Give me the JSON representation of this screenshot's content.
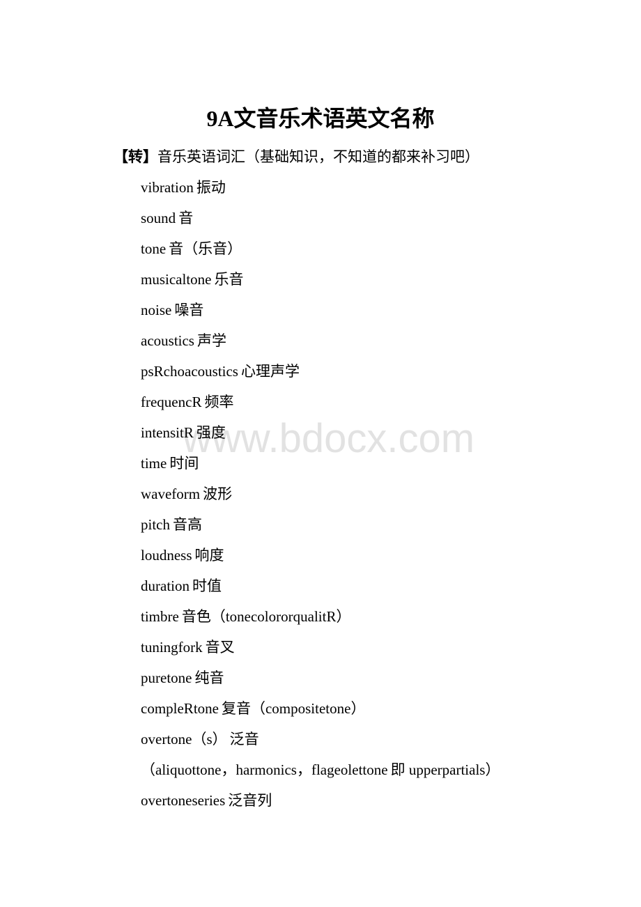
{
  "watermark": "www.bdocx.com",
  "document": {
    "title": "9A文音乐术语英文名称",
    "subtitle_tag": "【转】",
    "subtitle_text": "音乐英语词汇（基础知识，不知道的都来补习吧）",
    "terms": [
      {
        "en": "vibration",
        "zh": "振动"
      },
      {
        "en": "sound",
        "zh": "音"
      },
      {
        "en": "tone",
        "zh": "音（乐音）"
      },
      {
        "en": "musicaltone",
        "zh": "乐音"
      },
      {
        "en": "noise",
        "zh": "噪音"
      },
      {
        "en": "acoustics",
        "zh": "声学"
      },
      {
        "en": "psRchoacoustics",
        "zh": "心理声学"
      },
      {
        "en": "frequencR",
        "zh": "频率"
      },
      {
        "en": "intensitR",
        "zh": "强度"
      },
      {
        "en": "time",
        "zh": "时间"
      },
      {
        "en": "waveform",
        "zh": "波形"
      },
      {
        "en": "pitch",
        "zh": "音高"
      },
      {
        "en": "loudness",
        "zh": "响度"
      },
      {
        "en": "duration",
        "zh": "时值"
      },
      {
        "en": "timbre",
        "zh": "音色（tonecolororqualitR）"
      },
      {
        "en": "tuningfork",
        "zh": "音叉"
      },
      {
        "en": "puretone",
        "zh": "纯音"
      },
      {
        "en": "compleRtone",
        "zh": "复音（compositetone）"
      },
      {
        "en": "overtone（s）",
        "zh": "泛音"
      },
      {
        "en": "（aliquottone，harmonics，flageolettone",
        "zh": "即 upperpartials）"
      },
      {
        "en": "overtoneseries",
        "zh": "泛音列"
      }
    ]
  }
}
